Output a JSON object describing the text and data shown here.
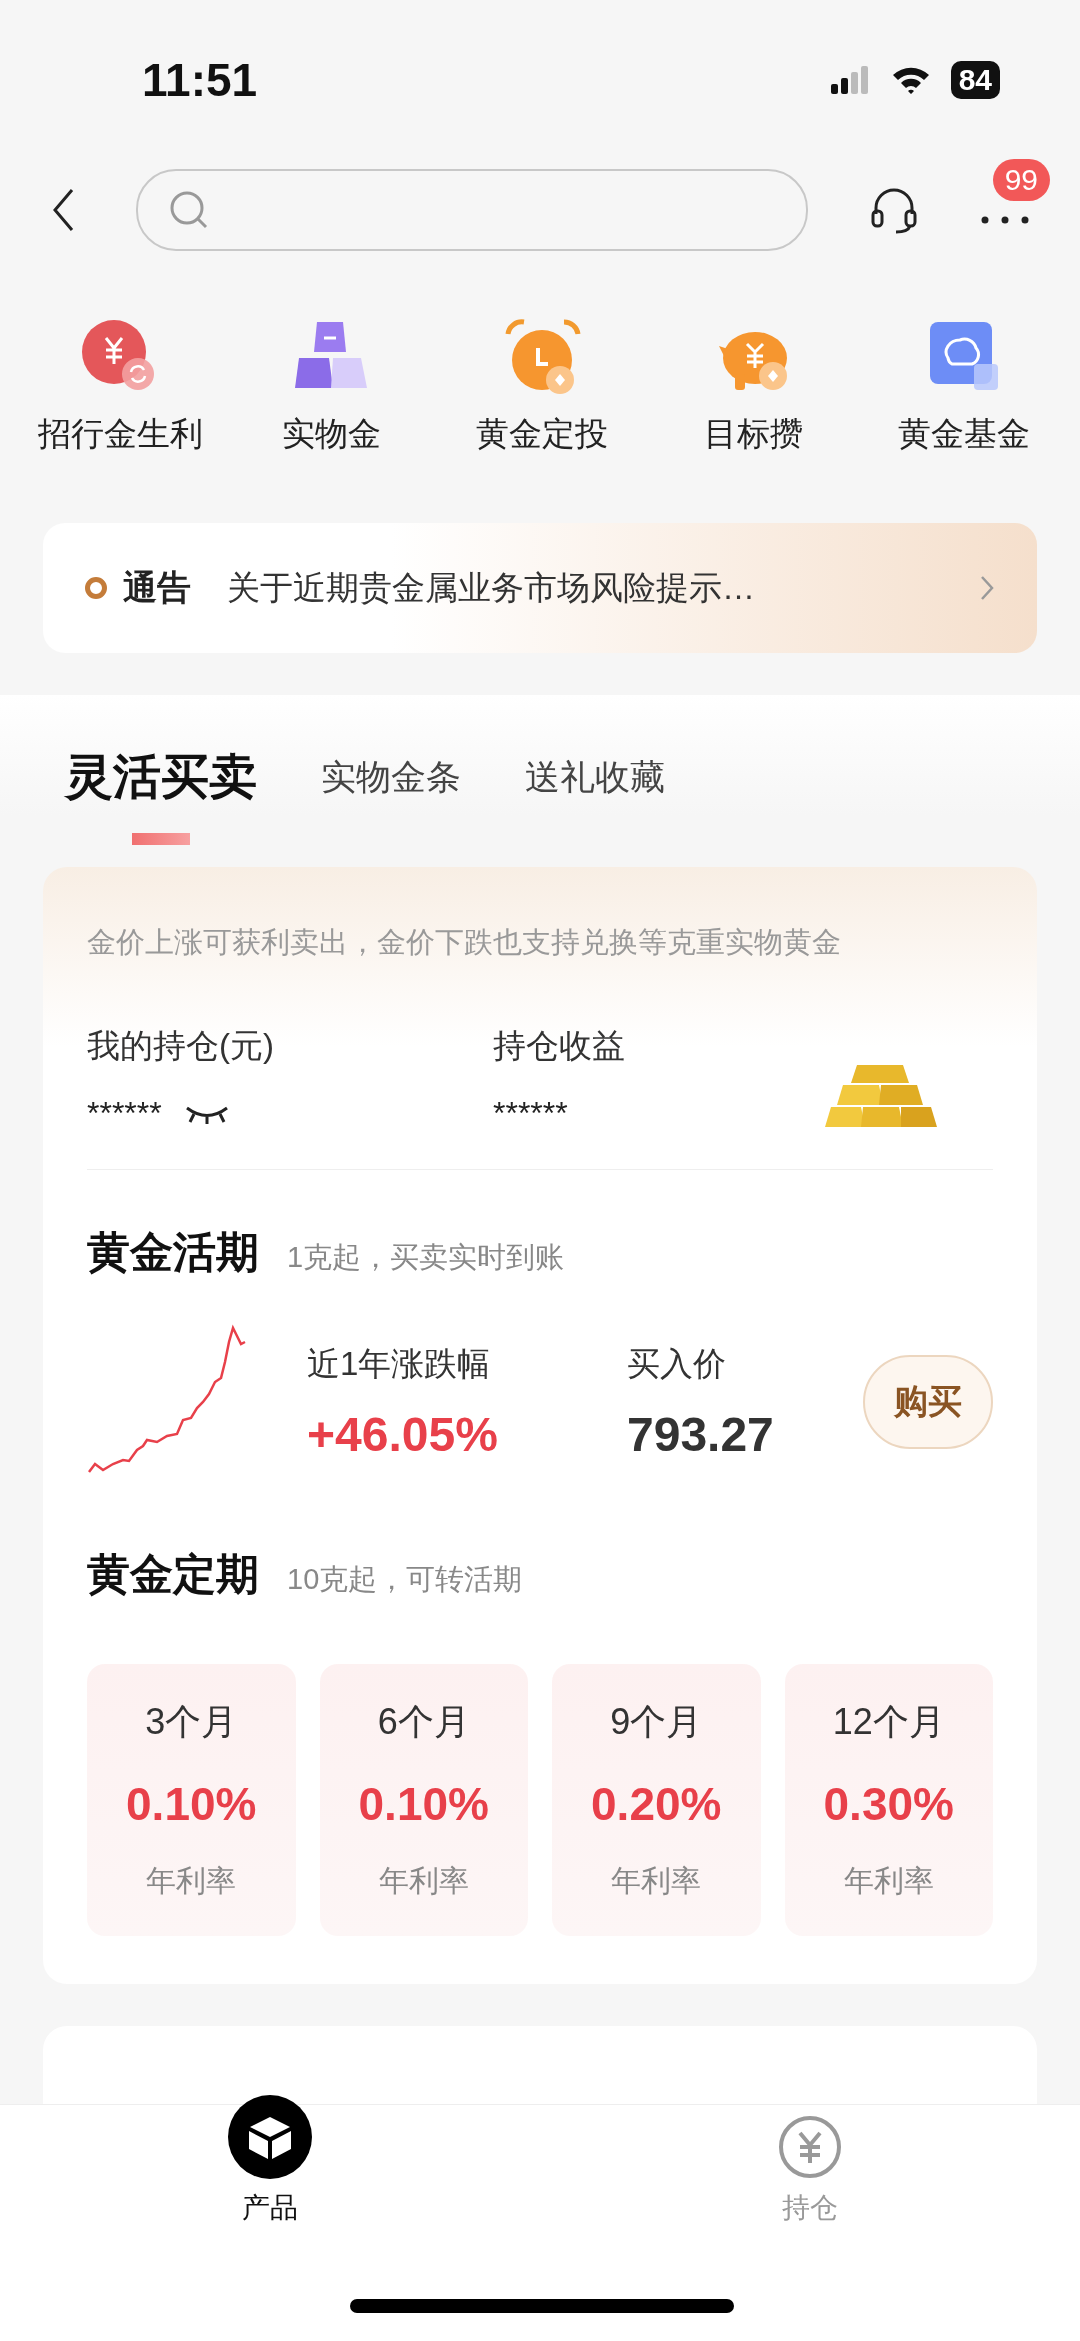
{
  "status_bar": {
    "time": "11:51",
    "battery": "84"
  },
  "nav": {
    "badge": "99"
  },
  "shortcuts": [
    {
      "label": "招行金生利"
    },
    {
      "label": "实物金"
    },
    {
      "label": "黄金定投"
    },
    {
      "label": "目标攒"
    },
    {
      "label": "黄金基金"
    }
  ],
  "notice": {
    "tag": "通告",
    "text": "关于近期贵金属业务市场风险提示…"
  },
  "tabs": [
    {
      "label": "灵活买卖",
      "selected": true
    },
    {
      "label": "实物金条",
      "selected": false
    },
    {
      "label": "送礼收藏",
      "selected": false
    }
  ],
  "holdings": {
    "hint": "金价上涨可获利卖出，金价下跌也支持兑换等克重实物黄金",
    "columns": [
      {
        "label": "我的持仓(元)",
        "value": "******"
      },
      {
        "label": "持仓收益",
        "value": "******"
      }
    ]
  },
  "demand": {
    "title": "黄金活期",
    "subtitle": "1克起，买卖实时到账",
    "change_label": "近1年涨跌幅",
    "change": "+46.05%",
    "price_label": "买入价",
    "price": "793.27",
    "button": "购买"
  },
  "fixed": {
    "title": "黄金定期",
    "subtitle": "10克起，可转活期",
    "terms": [
      {
        "term": "3个月",
        "rate": "0.10%",
        "rate_label": "年利率"
      },
      {
        "term": "6个月",
        "rate": "0.10%",
        "rate_label": "年利率"
      },
      {
        "term": "9个月",
        "rate": "0.20%",
        "rate_label": "年利率"
      },
      {
        "term": "12个月",
        "rate": "0.30%",
        "rate_label": "年利率"
      }
    ]
  },
  "bottom_tabs": [
    {
      "label": "产品",
      "selected": true
    },
    {
      "label": "持仓",
      "selected": false
    }
  ]
}
